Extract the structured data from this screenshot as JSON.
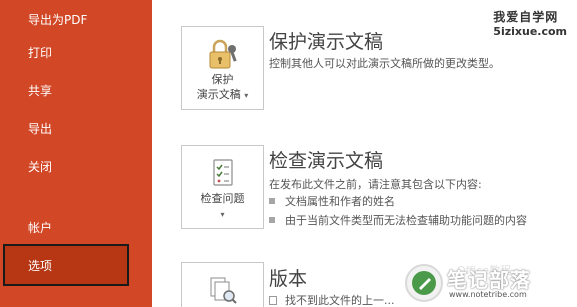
{
  "sidebar": {
    "items": [
      {
        "label": "导出为PDF"
      },
      {
        "label": "打印"
      },
      {
        "label": "共享"
      },
      {
        "label": "导出"
      },
      {
        "label": "关闭"
      },
      {
        "label": "帐户"
      },
      {
        "label": "选项"
      }
    ],
    "selected": "选项"
  },
  "protect": {
    "button_line1": "保护",
    "button_line2": "演示文稿",
    "title": "保护演示文稿",
    "description": "控制其他人可以对此演示文稿所做的更改类型。"
  },
  "inspect": {
    "button_label": "检查问题",
    "title": "检查演示文稿",
    "description": "在发布此文件之前，请注意其包含以下内容:",
    "bullets": [
      "文档属性和作者的姓名",
      "由于当前文件类型而无法检查辅助功能问题的内容"
    ]
  },
  "versions": {
    "title": "版本",
    "description": "找不到此文件的上一..."
  },
  "watermark": {
    "site_name": "我爱自学网",
    "site_url": "5izixue.com",
    "brand": "笔记部落",
    "brand_sub": "www.notetribe.com",
    "office": "Office教程"
  },
  "colors": {
    "sidebar_bg": "#d24726",
    "sidebar_selected": "#b73715"
  },
  "icons": {
    "protect": "lock-key-icon",
    "inspect": "checklist-icon",
    "versions": "document-magnifier-icon"
  }
}
